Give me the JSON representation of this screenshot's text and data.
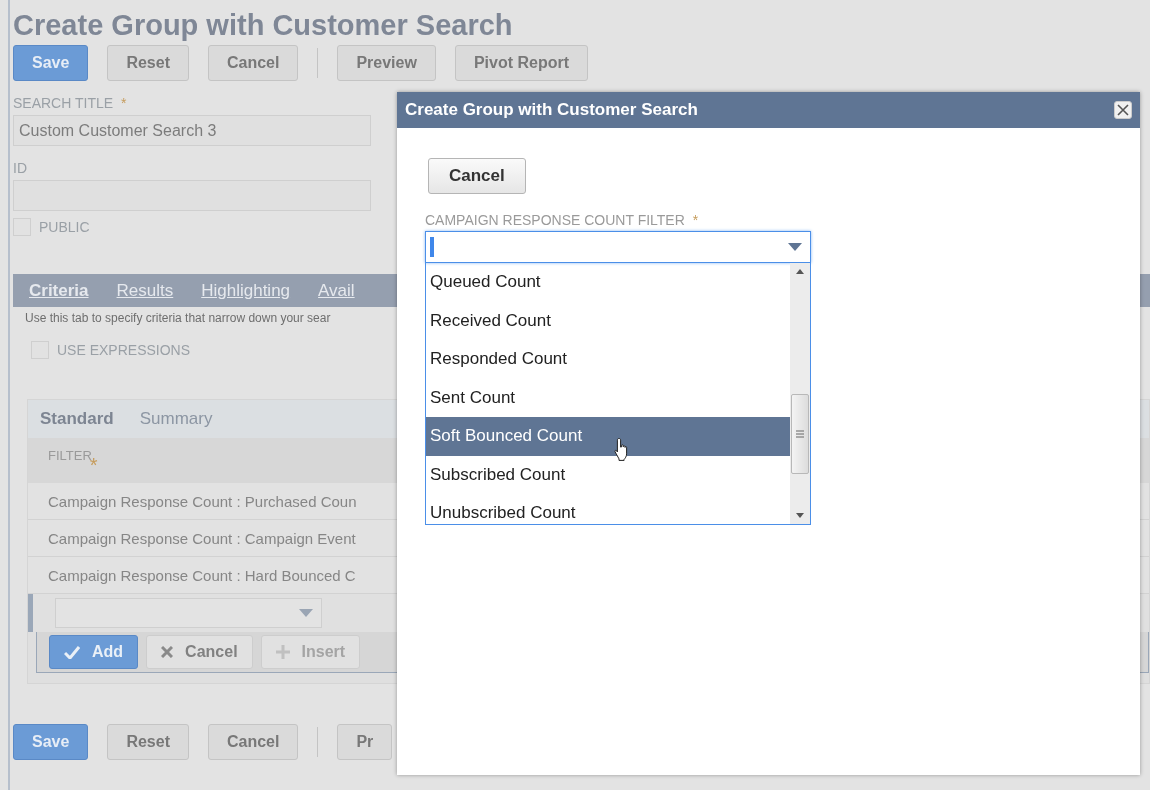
{
  "page": {
    "title": "Create Group with Customer Search",
    "buttons": [
      {
        "label": "Save",
        "kind": "primary"
      },
      {
        "label": "Reset"
      },
      {
        "label": "Cancel"
      }
    ],
    "more_buttons": [
      {
        "label": "Preview"
      },
      {
        "label": "Pivot Report"
      }
    ],
    "fields": [
      {
        "label": "SEARCH TITLE",
        "required_mark": "*",
        "value": "Custom Customer Search 3"
      },
      {
        "label": "ID"
      }
    ],
    "public": {
      "label": "PUBLIC",
      "checked": false
    },
    "tabs": [
      {
        "label": "Criteria",
        "selected": true
      },
      {
        "label": "Results",
        "selected": false
      },
      {
        "label": "Highlighting",
        "selected": false
      },
      {
        "label": "Avail",
        "selected": false
      }
    ],
    "tab_hint": "Use this tab to specify criteria that narrow down your sear",
    "use_expressions": {
      "label": "USE EXPRESSIONS",
      "checked": false
    },
    "subtabs": [
      {
        "label": "Standard",
        "selected": true
      },
      {
        "label": "Summary",
        "selected": false
      }
    ],
    "filter_header": {
      "label": "FILTER",
      "required_mark": "*"
    },
    "filter_rows": [
      "Campaign Response Count : Purchased Coun",
      "Campaign Response Count : Campaign Event",
      "Campaign Response Count : Hard Bounced C"
    ],
    "edit_buttons": [
      {
        "label": "Add",
        "kind": "add",
        "disabled": false
      },
      {
        "label": "Cancel",
        "kind": "cancel",
        "disabled": false
      },
      {
        "label": "Insert",
        "kind": "insert",
        "disabled": true
      }
    ],
    "bottom_buttons": [
      {
        "label": "Save",
        "kind": "primary"
      },
      {
        "label": "Reset"
      },
      {
        "label": "Cancel"
      }
    ],
    "bottom_more_buttons": [
      {
        "label": "Pr"
      }
    ]
  },
  "dialog": {
    "title": "Create Group with Customer Search",
    "cancel": "Cancel",
    "filter": {
      "label": "CAMPAIGN RESPONSE COUNT FILTER",
      "required_mark": "*",
      "options": [
        {
          "label": "Queued Count",
          "selected": false
        },
        {
          "label": "Received Count",
          "selected": false
        },
        {
          "label": "Responded Count",
          "selected": false
        },
        {
          "label": "Sent Count",
          "selected": false
        },
        {
          "label": "Soft Bounced Count",
          "selected": true
        },
        {
          "label": "Subscribed Count",
          "selected": false
        },
        {
          "label": "Unubscribed Count",
          "selected": false
        }
      ]
    }
  }
}
